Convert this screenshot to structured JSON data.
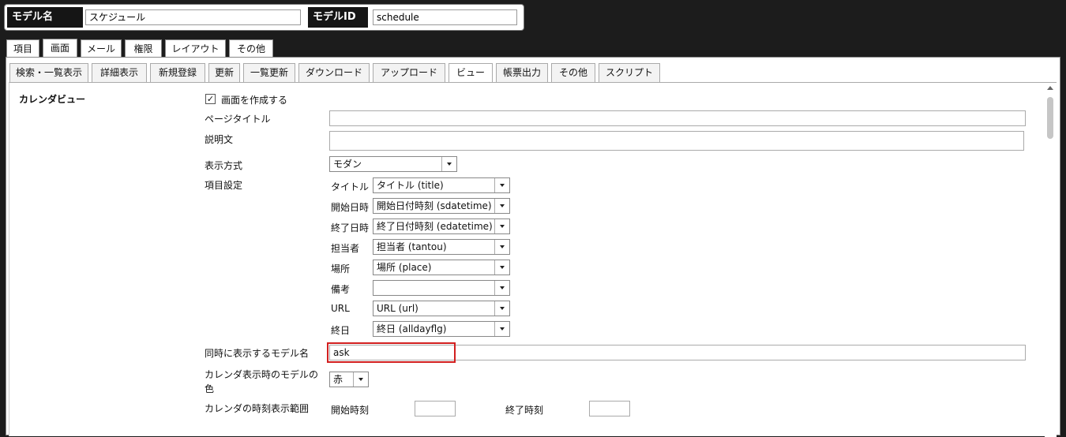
{
  "model": {
    "name_label": "モデル名",
    "name_value": "スケジュール",
    "id_label": "モデルID",
    "id_value": "schedule"
  },
  "top_tabs": [
    "項目",
    "画面",
    "メール",
    "権限",
    "レイアウト",
    "その他"
  ],
  "top_tabs_active": "画面",
  "sub_tabs": [
    "検索・一覧表示",
    "詳細表示",
    "新規登録",
    "更新",
    "一覧更新",
    "ダウンロード",
    "アップロード",
    "ビュー",
    "帳票出力",
    "その他",
    "スクリプト"
  ],
  "sub_tabs_active": "ビュー",
  "section_title": "カレンダビュー",
  "form": {
    "create_screen": {
      "label": "画面を作成する",
      "checked": true,
      "check_glyph": "✓"
    },
    "page_title": {
      "label": "ページタイトル",
      "value": ""
    },
    "description": {
      "label": "説明文",
      "value": ""
    },
    "display_mode": {
      "label": "表示方式",
      "value": "モダン"
    },
    "item_settings": {
      "label": "項目設定",
      "rows": [
        {
          "label": "タイトル",
          "value": "タイトル (title)"
        },
        {
          "label": "開始日時",
          "value": "開始日付時刻 (sdatetime)"
        },
        {
          "label": "終了日時",
          "value": "終了日付時刻 (edatetime)"
        },
        {
          "label": "担当者",
          "value": "担当者 (tantou)"
        },
        {
          "label": "場所",
          "value": "場所 (place)"
        },
        {
          "label": "備考",
          "value": ""
        },
        {
          "label": "URL",
          "value": "URL (url)"
        },
        {
          "label": "終日",
          "value": "終日 (alldayflg)"
        }
      ]
    },
    "concurrent_models": {
      "label": "同時に表示するモデル名",
      "value": "ask"
    },
    "model_color": {
      "label_line1": "カレンダ表示時のモデルの",
      "label_line2": "色",
      "value": "赤"
    },
    "time_range": {
      "label": "カレンダの時刻表示範囲",
      "start_label": "開始時刻",
      "start_value": "",
      "end_label": "終了時刻",
      "end_value": ""
    }
  },
  "colors": {
    "highlight": "#d21f1f",
    "header_bg": "#1c1c1c"
  }
}
